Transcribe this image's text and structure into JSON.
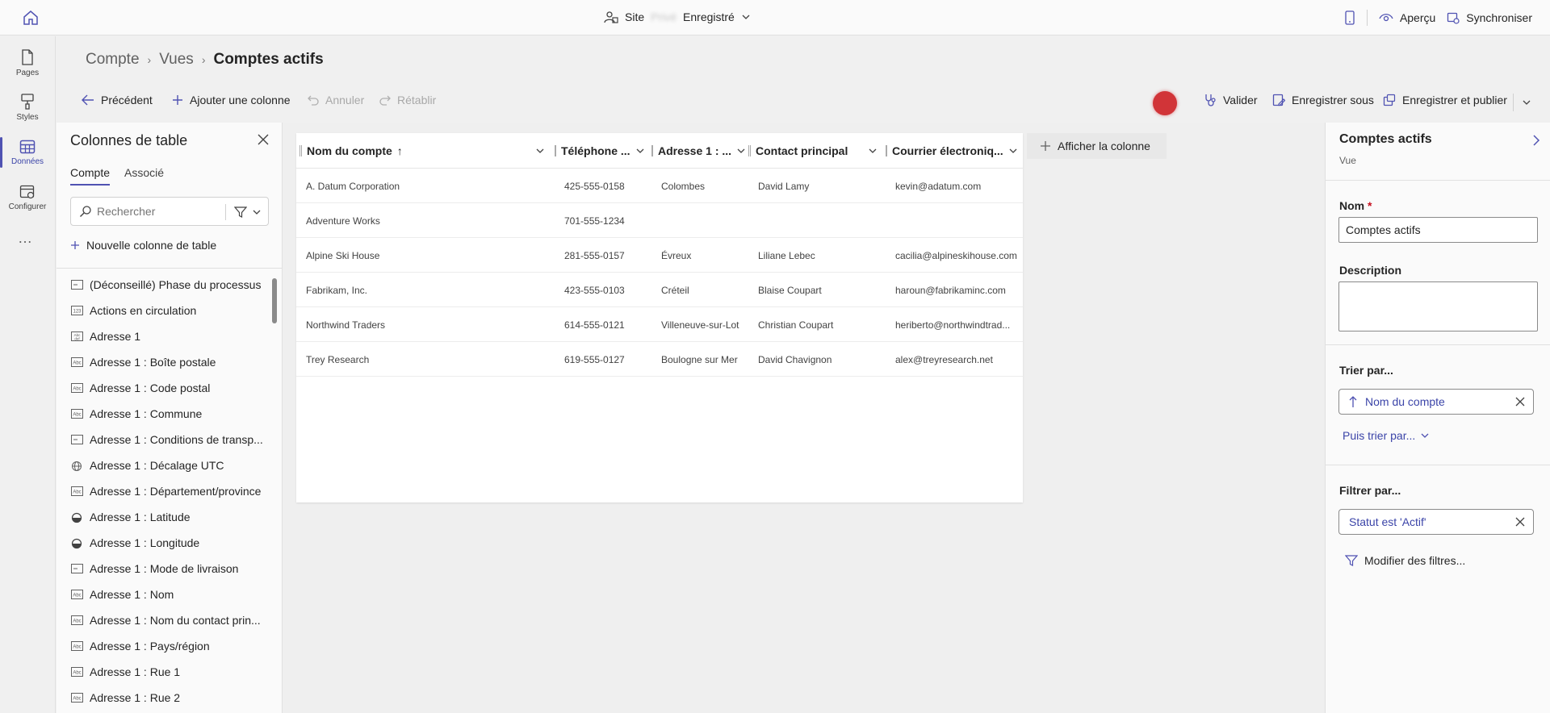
{
  "topbar": {
    "site_label": "Site",
    "site_name_blurred": "Privé",
    "status": "Enregistré",
    "preview_label": "Aperçu",
    "sync_label": "Synchroniser"
  },
  "rail": {
    "items": [
      {
        "label": "Pages",
        "icon": "page-icon"
      },
      {
        "label": "Styles",
        "icon": "brush-icon"
      },
      {
        "label": "Données",
        "icon": "table-icon",
        "active": true
      },
      {
        "label": "Configurer",
        "icon": "settings-icon"
      }
    ],
    "more": "…"
  },
  "breadcrumb": {
    "items": [
      "Compte",
      "Vues"
    ],
    "current": "Comptes actifs"
  },
  "commandbar": {
    "back": "Précédent",
    "add_column": "Ajouter une colonne",
    "undo": "Annuler",
    "redo": "Rétablir",
    "validate": "Valider",
    "save_as": "Enregistrer sous",
    "save_publish": "Enregistrer et publier"
  },
  "left_panel": {
    "title": "Colonnes de table",
    "tabs": [
      "Compte",
      "Associé"
    ],
    "search_placeholder": "Rechercher",
    "new_column": "Nouvelle colonne de table",
    "columns": [
      {
        "label": "(Déconseillé) Phase du processus",
        "icon": "option-set-icon"
      },
      {
        "label": "Actions en circulation",
        "icon": "number-icon"
      },
      {
        "label": "Adresse 1",
        "icon": "text-area-icon"
      },
      {
        "label": "Adresse 1 : Boîte postale",
        "icon": "text-icon"
      },
      {
        "label": "Adresse 1 : Code postal",
        "icon": "text-icon"
      },
      {
        "label": "Adresse 1 : Commune",
        "icon": "text-icon"
      },
      {
        "label": "Adresse 1 : Conditions de transp...",
        "icon": "option-set-icon"
      },
      {
        "label": "Adresse 1 : Décalage UTC",
        "icon": "globe-icon"
      },
      {
        "label": "Adresse 1 : Département/province",
        "icon": "text-icon"
      },
      {
        "label": "Adresse 1 : Latitude",
        "icon": "half-circle-icon"
      },
      {
        "label": "Adresse 1 : Longitude",
        "icon": "half-circle-icon"
      },
      {
        "label": "Adresse 1 : Mode de livraison",
        "icon": "option-set-icon"
      },
      {
        "label": "Adresse 1 : Nom",
        "icon": "text-icon"
      },
      {
        "label": "Adresse 1 : Nom du contact prin...",
        "icon": "text-icon"
      },
      {
        "label": "Adresse 1 : Pays/région",
        "icon": "text-icon"
      },
      {
        "label": "Adresse 1 : Rue 1",
        "icon": "text-icon"
      },
      {
        "label": "Adresse 1 : Rue 2",
        "icon": "text-icon"
      }
    ]
  },
  "grid": {
    "columns": [
      {
        "label": "Nom du compte",
        "sort": "↑"
      },
      {
        "label": "Téléphone ..."
      },
      {
        "label": "Adresse 1 : ..."
      },
      {
        "label": "Contact principal"
      },
      {
        "label": "Courrier électroniq..."
      }
    ],
    "rows": [
      [
        "A. Datum Corporation",
        "425-555-0158",
        "Colombes",
        "David Lamy",
        "kevin@adatum.com"
      ],
      [
        "Adventure Works",
        "701-555-1234",
        "",
        "",
        ""
      ],
      [
        "Alpine Ski House",
        "281-555-0157",
        "Évreux",
        "Liliane Lebec",
        "cacilia@alpineskihouse.com"
      ],
      [
        "Fabrikam, Inc.",
        "423-555-0103",
        "Créteil",
        "Blaise Coupart",
        "haroun@fabrikaminc.com"
      ],
      [
        "Northwind Traders",
        "614-555-0121",
        "Villeneuve-sur-Lot",
        "Christian Coupart",
        "heriberto@northwindtrad..."
      ],
      [
        "Trey Research",
        "619-555-0127",
        "Boulogne sur Mer",
        "David Chavignon",
        "alex@treyresearch.net"
      ]
    ],
    "add_column": "Afficher la colonne"
  },
  "right_panel": {
    "title": "Comptes actifs",
    "subtitle": "Vue",
    "name_label": "Nom",
    "name_required": "*",
    "name_value": "Comptes actifs",
    "description_label": "Description",
    "sort_label": "Trier par...",
    "sort_value": "Nom du compte",
    "then_sort": "Puis trier par...",
    "filter_label": "Filtrer par...",
    "filter_value": "Statut est 'Actif'",
    "edit_filters": "Modifier des filtres..."
  },
  "colors": {
    "accent": "#4f52b2",
    "link": "#3b44a8",
    "required": "#c50f1f",
    "avatar": "#d13438"
  }
}
